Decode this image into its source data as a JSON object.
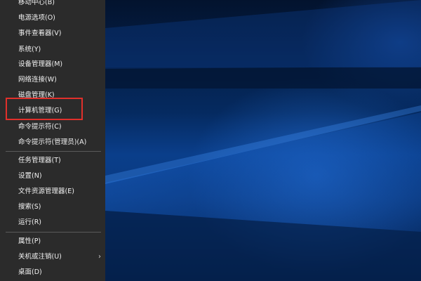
{
  "context_menu": {
    "items": [
      {
        "label": "移动中心(B)"
      },
      {
        "label": "电源选项(O)"
      },
      {
        "label": "事件查看器(V)"
      },
      {
        "label": "系统(Y)"
      },
      {
        "label": "设备管理器(M)"
      },
      {
        "label": "网络连接(W)"
      },
      {
        "label": "磁盘管理(K)"
      },
      {
        "label": "计算机管理(G)"
      },
      {
        "label": "命令提示符(C)"
      },
      {
        "label": "命令提示符(管理员)(A)"
      },
      {
        "label": "任务管理器(T)"
      },
      {
        "label": "设置(N)"
      },
      {
        "label": "文件资源管理器(E)"
      },
      {
        "label": "搜索(S)"
      },
      {
        "label": "运行(R)"
      },
      {
        "label": "属性(P)"
      },
      {
        "label": "关机或注销(U)"
      },
      {
        "label": "桌面(D)"
      }
    ],
    "submenu_icon": "chevron-right-icon",
    "highlighted_item": "计算机管理(G)"
  },
  "colors": {
    "menu_background": "#2b2b2b",
    "menu_text": "#f2f2f2",
    "highlight_border": "#e0302b",
    "wallpaper_blue": "#0a3e8a"
  }
}
